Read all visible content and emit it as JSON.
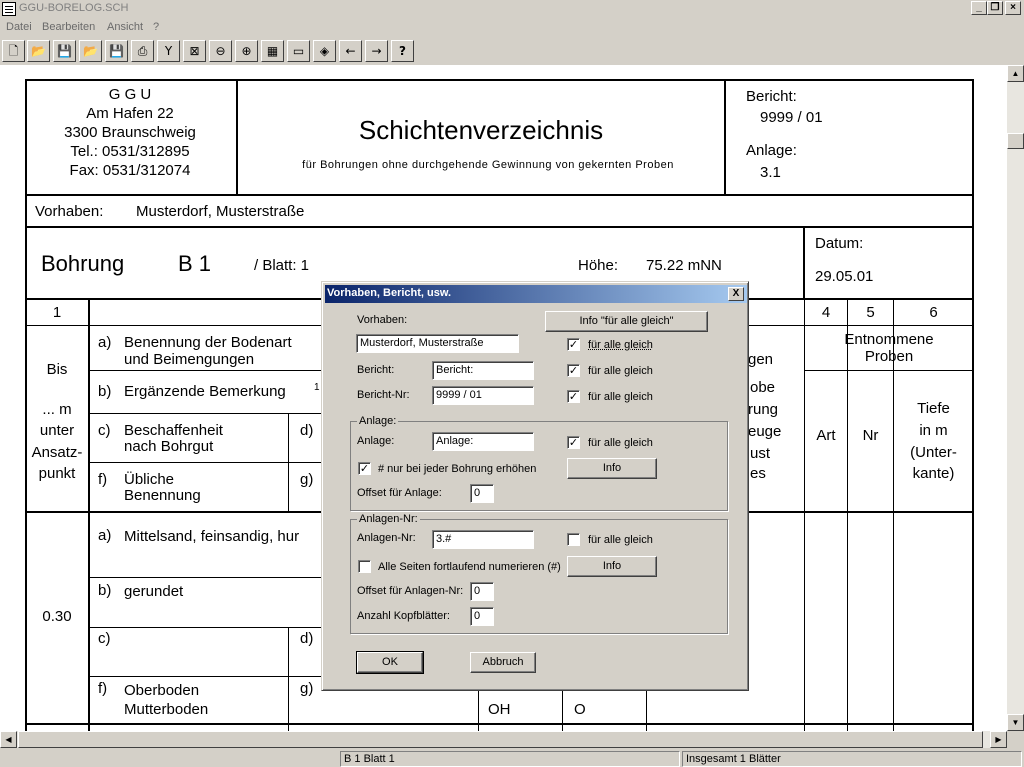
{
  "window": {
    "title": "GGU-BORELOG.SCH"
  },
  "menu": [
    "Datei",
    "Bearbeiten",
    "Ansicht",
    "?"
  ],
  "toolbar_icons": [
    "new-icon",
    "open-icon",
    "save-icon",
    "open-folder-icon",
    "save-as-icon",
    "print-icon",
    "tool-icon",
    "crop-icon",
    "zoom-out-icon",
    "zoom-in-icon",
    "layout-icon",
    "folders-icon",
    "color-icon",
    "arrow-left-icon",
    "arrow-right-icon",
    "help-icon"
  ],
  "header": {
    "company": [
      "G G U",
      "Am Hafen 22",
      "3300 Braunschweig",
      "Tel.: 0531/312895",
      "Fax: 0531/312074"
    ],
    "title": "Schichtenverzeichnis",
    "subtitle": "für Bohrungen ohne durchgehende Gewinnung von gekernten Proben",
    "bericht_label": "Bericht:",
    "bericht_value": "9999 / 01",
    "anlage_label": "Anlage:",
    "anlage_value": "3.1",
    "vorhaben_label": "Vorhaben:",
    "vorhaben_value": "Musterdorf, Musterstraße",
    "bohrung_label": "Bohrung",
    "bohrung_value": "B 1",
    "blatt": "/ Blatt: 1",
    "hoehe_label": "Höhe:",
    "hoehe_value": "75.22 mNN",
    "datum_label": "Datum:",
    "datum_value": "29.05.01"
  },
  "table": {
    "col_numbers": [
      "1",
      "4",
      "5",
      "6"
    ],
    "bis": "Bis",
    "m": "... m",
    "unter": "unter",
    "ansatz": "Ansatz-",
    "punkt": "punkt",
    "a_label": "a)",
    "a_text1": "Benennung der Bodenart",
    "a_text2": "und Beimengungen",
    "b_label": "b)",
    "b_text": "Ergänzende Bemerkung",
    "b_sup": "1",
    "c_label": "c)",
    "c_text1": "Beschaffenheit",
    "c_text2": "nach Bohrgut",
    "d_label": "d)",
    "f_label": "f)",
    "f_text1": "Übliche",
    "f_text2": "Benennung",
    "g_label": "g)",
    "gen": "gen",
    "obe": "obe",
    "rung": "rung",
    "euge": "euge",
    "ust": "ust",
    "es": "es",
    "entnommene1": "Entnommene",
    "entnommene2": "Proben",
    "art": "Art",
    "nr": "Nr",
    "tiefe1": "Tiefe",
    "tiefe2": "in m",
    "tiefe3": "(Unter-",
    "tiefe4": "kante)",
    "row1_depth": "0.30",
    "row1_a": "Mittelsand, feinsandig, hur",
    "row1_b": "gerundet",
    "row1_f1": "Oberboden",
    "row1_f2": "Mutterboden",
    "row1_h": "OH",
    "row1_i": "O"
  },
  "dialog": {
    "title": "Vorhaben, Bericht, usw.",
    "close": "X",
    "vorhaben_label": "Vorhaben:",
    "info_all_button": "Info \"für alle  gleich\"",
    "vorhaben_value": "Musterdorf, Musterstraße",
    "fuer_alle_gleich": "für alle gleich",
    "bericht_label": "Bericht:",
    "bericht_value": "Bericht:",
    "berichtnr_label": "Bericht-Nr:",
    "berichtnr_value": "9999 / 01",
    "group_anlage": "Anlage:",
    "anlage_label": "Anlage:",
    "anlage_value": "Anlage:",
    "nur_jeder": "# nur bei jeder Bohrung erhöhen",
    "info_button": "Info",
    "offset_anlage_label": "Offset für Anlage:",
    "offset_anlage_value": "0",
    "group_anlagennr": "Anlagen-Nr:",
    "anlagennr_label": "Anlagen-Nr:",
    "anlagennr_value": "3.#",
    "alle_seiten": "Alle Seiten fortlaufend numerieren (#)",
    "offset_anlagennr_label": "Offset für Anlagen-Nr:",
    "offset_anlagennr_value": "0",
    "anzahl_label": "Anzahl Kopfblätter:",
    "anzahl_value": "0",
    "ok_button": "OK",
    "cancel_button": "Abbruch",
    "check_marks": {
      "vorhaben": true,
      "bericht": true,
      "berichtnr": true,
      "anlage": true,
      "nur_jeder": true,
      "anlagennr": false,
      "alle_seiten": false
    },
    "check_glyph": "✓"
  },
  "status": {
    "left": "B 1   Blatt 1",
    "right": "Insgesamt 1 Blätter"
  }
}
